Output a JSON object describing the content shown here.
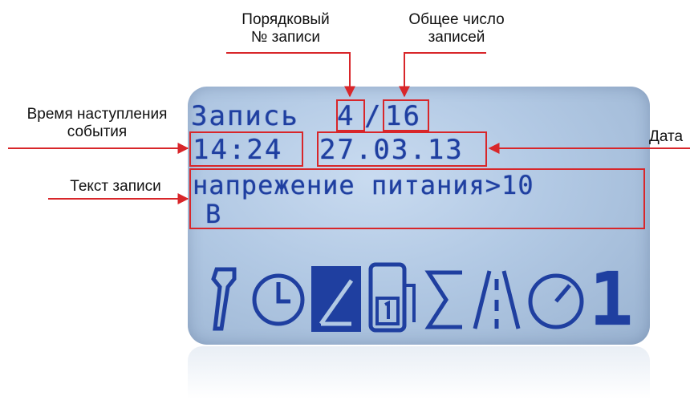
{
  "callouts": {
    "record_number_line1": "Порядковый",
    "record_number_line2": "№ записи",
    "total_line1": "Общее число",
    "total_line2": "записей",
    "event_time_line1": "Время наступления",
    "event_time_line2": "события",
    "date": "Дата",
    "record_text": "Текст записи"
  },
  "display": {
    "header_word": "Запись",
    "current_record": "4",
    "separator": "/",
    "total_records": "16",
    "time": "14:24",
    "date": "27.03.13",
    "message_line1": "напрежение питания>10",
    "message_line2": "B",
    "page_indicator": "1"
  },
  "icons": [
    "wrench-icon",
    "clock-icon",
    "journal-edit-icon",
    "fuel-meter-icon",
    "sigma-icon",
    "road-icon",
    "speedometer-icon"
  ],
  "colors": {
    "lcd_text": "#1f3fa0",
    "lcd_background": "#b2c9e4",
    "annotation": "#d8262a"
  }
}
